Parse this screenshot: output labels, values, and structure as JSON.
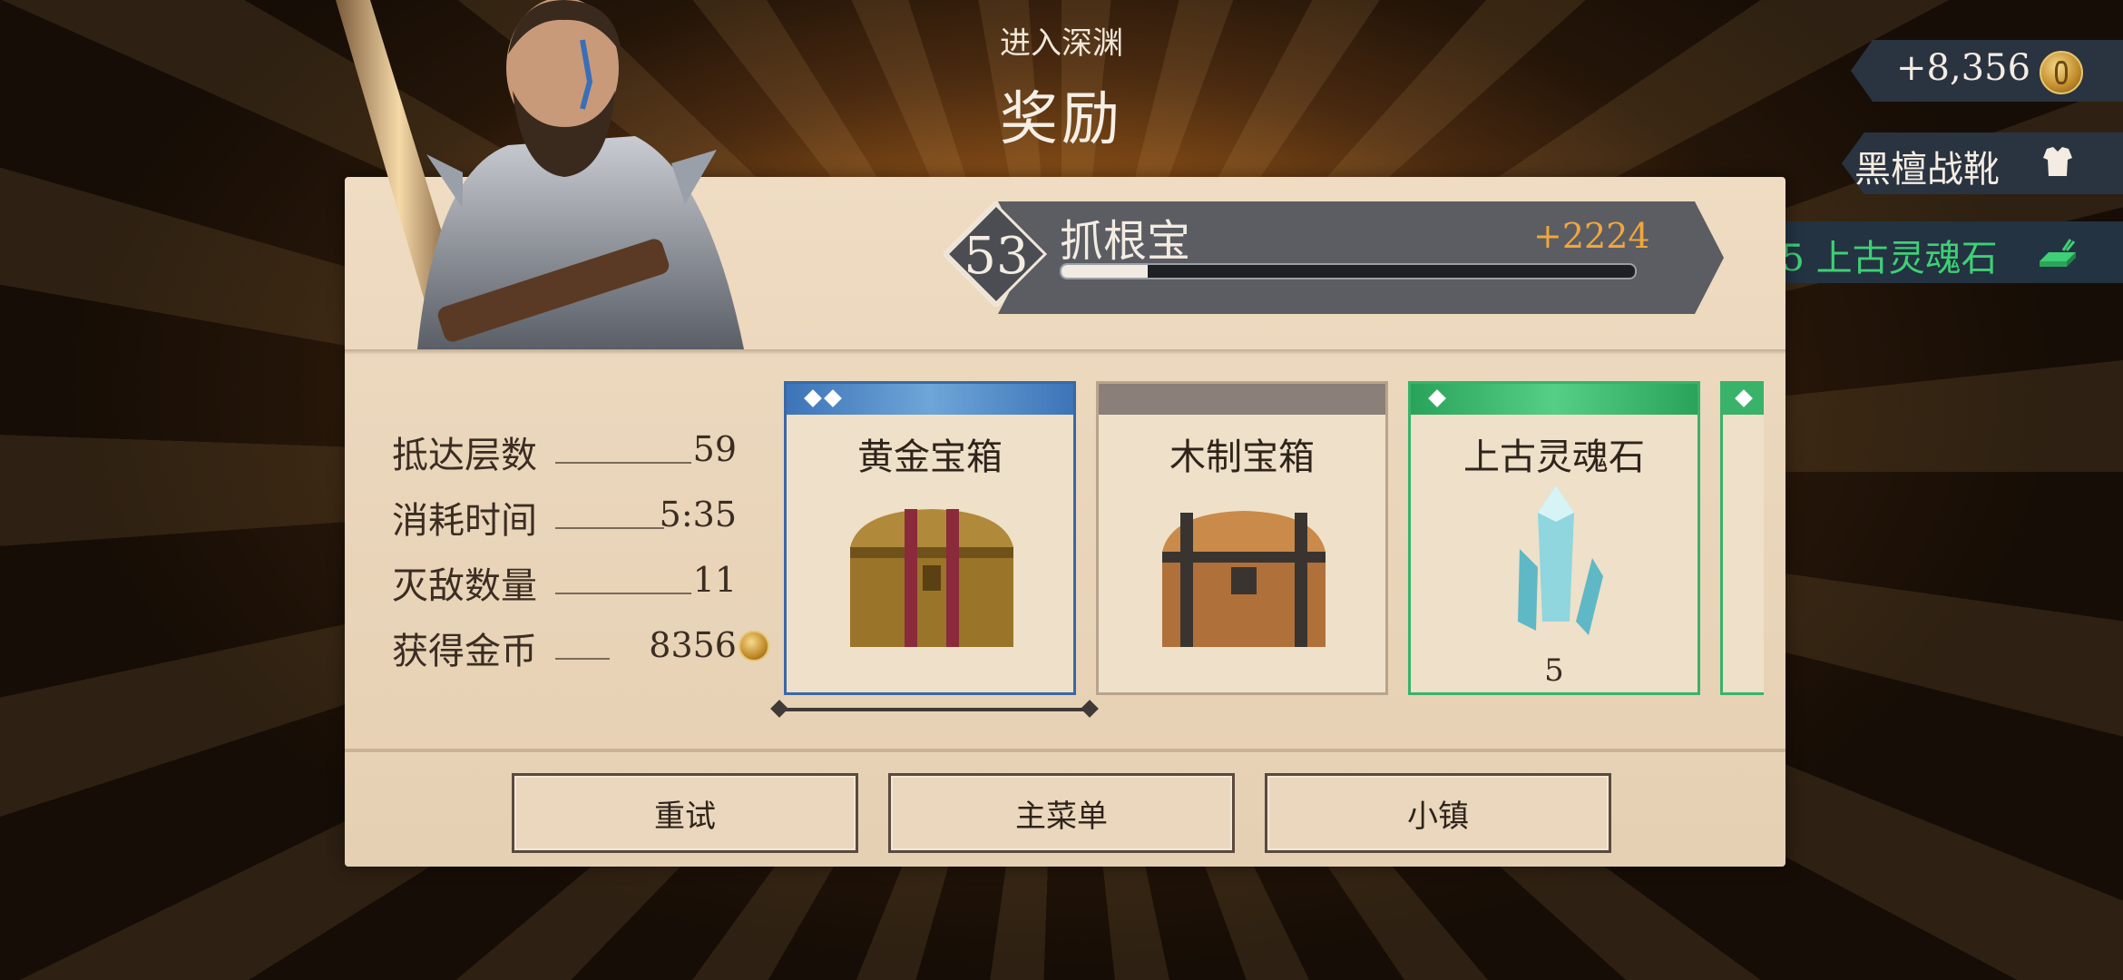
{
  "header": {
    "subtitle": "进入深渊",
    "title": "奖励"
  },
  "player": {
    "level": "53",
    "name": "抓根宝",
    "xp_gain": "+2224",
    "xp_progress": 0.15
  },
  "notifications": [
    {
      "text": "+8,356",
      "icon": "gold-coin-icon"
    },
    {
      "text": "黑檀战靴",
      "icon": "armor-icon"
    },
    {
      "text": "+5 上古灵魂石",
      "icon": "ingot-icon",
      "color": "#3fcf74"
    }
  ],
  "stats": [
    {
      "label": "抵达层数",
      "value": "59"
    },
    {
      "label": "消耗时间",
      "value": "5:35"
    },
    {
      "label": "灭敌数量",
      "value": "11"
    },
    {
      "label": "获得金币",
      "value": "8356"
    }
  ],
  "rewards": [
    {
      "label": "黄金宝箱",
      "rarity_color": "#3d74b8",
      "quantity": ""
    },
    {
      "label": "木制宝箱",
      "rarity_color": "#8a8079",
      "quantity": ""
    },
    {
      "label": "上古灵魂石",
      "rarity_color": "#2aa35a",
      "quantity": "5"
    }
  ],
  "buttons": {
    "retry": "重试",
    "main_menu": "主菜单",
    "town": "小镇"
  },
  "colors": {
    "accent_gold": "#f0a73c",
    "panel": "#ead6bb",
    "banner": "#5b5d63",
    "green": "#3fcf74"
  }
}
